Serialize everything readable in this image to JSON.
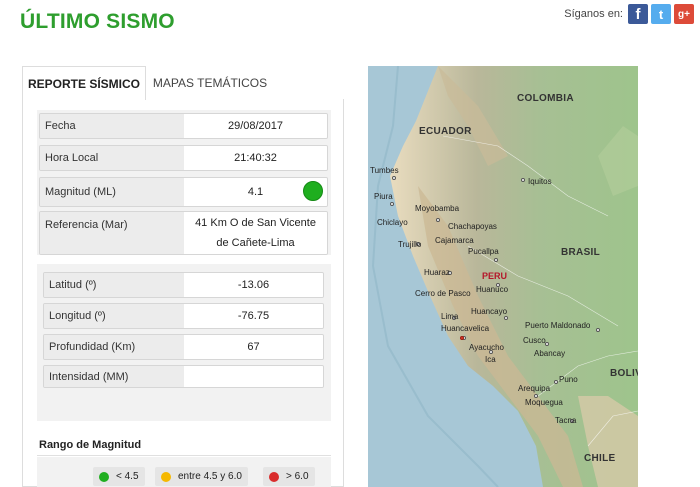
{
  "header": {
    "title": "ÚLTIMO SISMO",
    "follow_label": "Síganos en:",
    "social": [
      {
        "name": "facebook-icon",
        "glyph": "f"
      },
      {
        "name": "twitter-icon",
        "glyph": "t"
      },
      {
        "name": "google-plus-icon",
        "glyph": "g+"
      }
    ]
  },
  "tabs": [
    {
      "label": "REPORTE SÍSMICO",
      "active": true
    },
    {
      "label": "MAPAS TEMÁTICOS",
      "active": false
    }
  ],
  "report": {
    "fecha_label": "Fecha",
    "fecha": "29/08/2017",
    "hora_label": "Hora Local",
    "hora": "21:40:32",
    "magnitud_label": "Magnitud (ML)",
    "magnitud": "4.1",
    "referencia_label": "Referencia (Mar)",
    "referencia": "41 Km O de San Vicente de Cañete-Lima",
    "latitud_label": "Latitud (º)",
    "latitud": "-13.06",
    "longitud_label": "Longitud (º)",
    "longitud": "-76.75",
    "profundidad_label": "Profundidad (Km)",
    "profundidad": "67",
    "intensidad_label": "Intensidad (MM)",
    "intensidad": ""
  },
  "range": {
    "title": "Rango de Magnitud",
    "items": [
      {
        "label": "< 4.5",
        "color": "#1fae1f"
      },
      {
        "label": "entre 4.5 y 6.0",
        "color": "#f5b800"
      },
      {
        "label": "> 6.0",
        "color": "#d92b2b"
      }
    ]
  },
  "map": {
    "countries": [
      "COLOMBIA",
      "ECUADOR",
      "BRASIL",
      "PERU",
      "BOLIV",
      "CHILE"
    ],
    "cities": [
      "Iquitos",
      "Tumbes",
      "Piura",
      "Chiclayo",
      "Moyobamba",
      "Chachapoyas",
      "Cajamarca",
      "Trujillo",
      "Pucallpa",
      "Huaraz",
      "Cerro de Pasco",
      "Huanuco",
      "Lima",
      "Huancayo",
      "Huancavelica",
      "Ayacucho",
      "Ica",
      "Puerto Maldonado",
      "Cusco",
      "Abancay",
      "Puno",
      "Arequipa",
      "Moquegua",
      "Tacna"
    ]
  }
}
